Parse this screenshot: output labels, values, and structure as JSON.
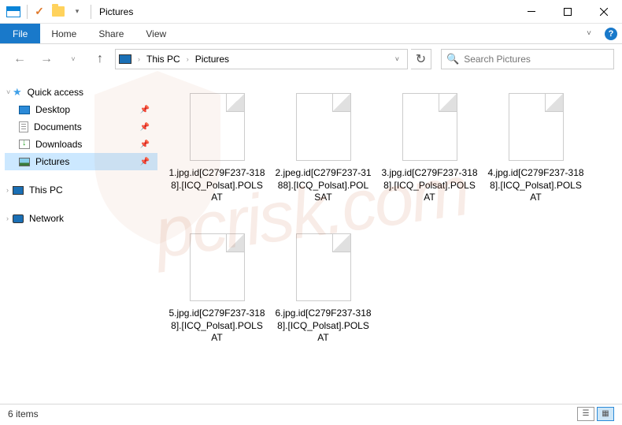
{
  "titlebar": {
    "title": "Pictures"
  },
  "ribbon": {
    "file": "File",
    "tabs": [
      "Home",
      "Share",
      "View"
    ]
  },
  "breadcrumb": {
    "root_icon": "monitor",
    "items": [
      "This PC",
      "Pictures"
    ]
  },
  "search": {
    "placeholder": "Search Pictures"
  },
  "sidebar": {
    "quick_access": "Quick access",
    "quick_items": [
      {
        "label": "Desktop",
        "icon": "desktop",
        "pinned": true
      },
      {
        "label": "Documents",
        "icon": "doc",
        "pinned": true
      },
      {
        "label": "Downloads",
        "icon": "download",
        "pinned": true
      },
      {
        "label": "Pictures",
        "icon": "pic",
        "pinned": true,
        "selected": true
      }
    ],
    "this_pc": "This PC",
    "network": "Network"
  },
  "files": [
    "1.jpg.id[C279F237-3188].[ICQ_Polsat].POLSAT",
    "2.jpeg.id[C279F237-3188].[ICQ_Polsat].POLSAT",
    "3.jpg.id[C279F237-3188].[ICQ_Polsat].POLSAT",
    "4.jpg.id[C279F237-3188].[ICQ_Polsat].POLSAT",
    "5.jpg.id[C279F237-3188].[ICQ_Polsat].POLSAT",
    "6.jpg.id[C279F237-3188].[ICQ_Polsat].POLSAT"
  ],
  "status": {
    "count": "6 items"
  },
  "watermark": "pcrisk.com"
}
